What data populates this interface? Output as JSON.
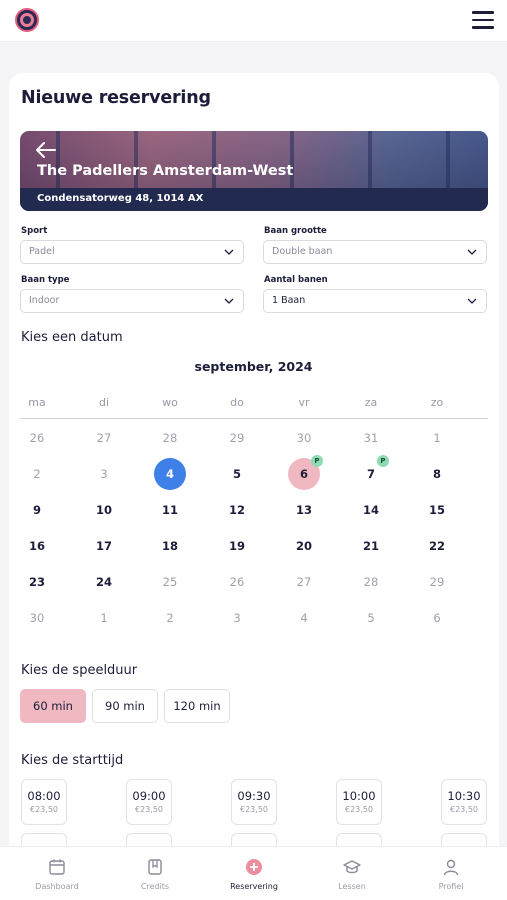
{
  "page": {
    "title": "Nieuwe reservering"
  },
  "venue": {
    "name": "The Padellers Amsterdam-West",
    "address": "Condensatorweg 48, 1014 AX"
  },
  "filters": {
    "sport": {
      "label": "Sport",
      "value": "Padel"
    },
    "court_size": {
      "label": "Baan grootte",
      "value": "Double baan"
    },
    "court_type": {
      "label": "Baan type",
      "value": "Indoor"
    },
    "court_count": {
      "label": "Aantal banen",
      "value": "1 Baan"
    }
  },
  "calendar": {
    "heading": "Kies een datum",
    "month": "september, 2024",
    "weekdays": [
      "ma",
      "di",
      "wo",
      "do",
      "vr",
      "za",
      "zo"
    ],
    "weeks": [
      [
        "26",
        "27",
        "28",
        "29",
        "30",
        "31",
        "1"
      ],
      [
        "2",
        "3",
        "4",
        "5",
        "6",
        "7",
        "8"
      ],
      [
        "9",
        "10",
        "11",
        "12",
        "13",
        "14",
        "15"
      ],
      [
        "16",
        "17",
        "18",
        "19",
        "20",
        "21",
        "22"
      ],
      [
        "23",
        "24",
        "25",
        "26",
        "27",
        "28",
        "29"
      ],
      [
        "30",
        "1",
        "2",
        "3",
        "4",
        "5",
        "6"
      ]
    ],
    "badge_label": "P"
  },
  "duration": {
    "heading": "Kies de speelduur",
    "options": [
      "60 min",
      "90 min",
      "120 min"
    ],
    "selected": "60 min"
  },
  "start_time": {
    "heading": "Kies de starttijd",
    "slots": [
      {
        "time": "08:00",
        "price": "€23,50"
      },
      {
        "time": "09:00",
        "price": "€23,50"
      },
      {
        "time": "09:30",
        "price": "€23,50"
      },
      {
        "time": "10:00",
        "price": "€23,50"
      },
      {
        "time": "10:30",
        "price": "€23,50"
      }
    ]
  },
  "nav": {
    "items": [
      {
        "label": "Dashboard",
        "icon": "calendar-icon"
      },
      {
        "label": "Credits",
        "icon": "bookmark-icon"
      },
      {
        "label": "Reservering",
        "icon": "plus-circle-icon"
      },
      {
        "label": "Lessen",
        "icon": "graduation-cap-icon"
      },
      {
        "label": "Profiel",
        "icon": "user-icon"
      }
    ],
    "active": "Reservering"
  },
  "colors": {
    "primary_dark": "#1d1d3a",
    "accent_pink": "#f0b9c2",
    "accent_pink_strong": "#e35d7a",
    "today_blue": "#3f80e8",
    "badge_green": "#8fd9b4"
  }
}
